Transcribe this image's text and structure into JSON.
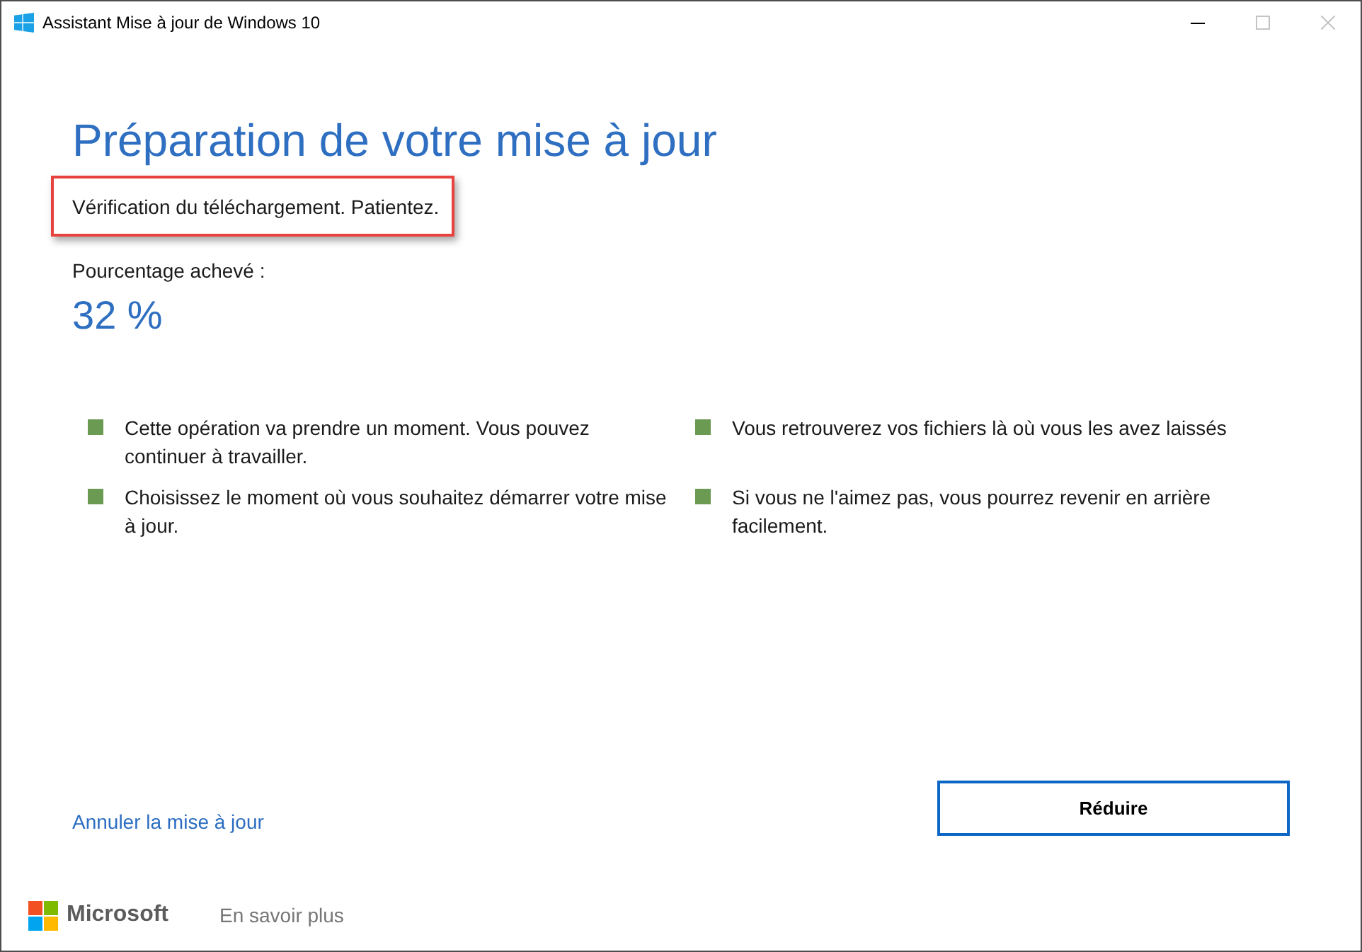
{
  "window": {
    "title": "Assistant Mise à jour de Windows 10",
    "controls": [
      {
        "kind": "minimize",
        "disabled": false
      },
      {
        "kind": "maximize",
        "disabled": true
      },
      {
        "kind": "close",
        "disabled": true
      }
    ]
  },
  "heading": "Préparation de votre mise à jour",
  "status": {
    "text": "Vérification du téléchargement. Patientez.",
    "highlighted": true
  },
  "progress": {
    "label": "Pourcentage achevé :",
    "value": "32 %"
  },
  "notes": [
    "Cette opération va prendre un moment. Vous pouvez continuer à travailler.",
    "Vous retrouverez vos fichiers là où vous les avez laissés",
    "Choisissez le moment où vous souhaitez démarrer votre mise à jour.",
    "Si vous ne l'aimez pas, vous pourrez revenir en arrière facilement."
  ],
  "cancel_link": "Annuler la mise à jour",
  "reduce_button": "Réduire",
  "footer": {
    "brand": "Microsoft",
    "learn_more": "En savoir plus"
  }
}
